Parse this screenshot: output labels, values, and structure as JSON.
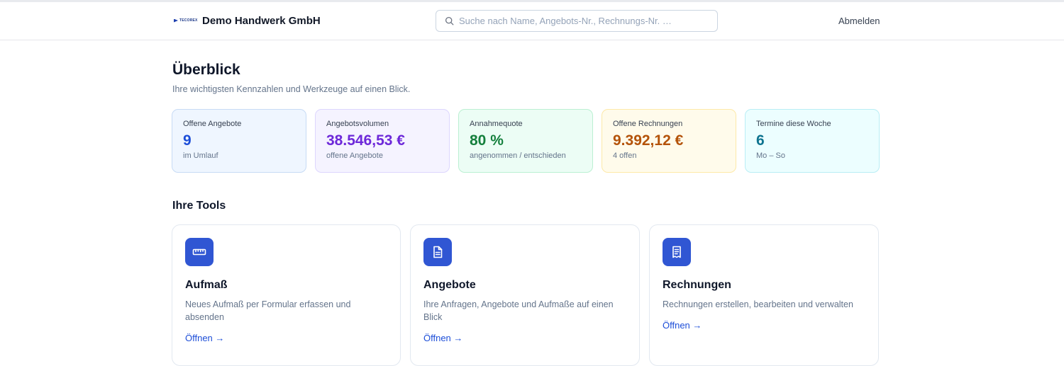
{
  "header": {
    "logo_text": "TECOREX",
    "company_name": "Demo Handwerk GmbH",
    "search": {
      "placeholder": "Suche nach Name, Angebots-Nr., Rechnungs-Nr. …",
      "value": ""
    },
    "logout_label": "Abmelden"
  },
  "page": {
    "title": "Überblick",
    "subtitle": "Ihre wichtigsten Kennzahlen und Werkzeuge auf einen Blick."
  },
  "kpis": [
    {
      "label": "Offene Angebote",
      "value": "9",
      "sub": "im Umlauf",
      "color": "#1d4ed8"
    },
    {
      "label": "Angebotsvolumen",
      "value": "38.546,53 €",
      "sub": "offene Angebote",
      "color": "#6d28d9"
    },
    {
      "label": "Annahmequote",
      "value": "80 %",
      "sub": "angenommen / entschieden",
      "color": "#15803d"
    },
    {
      "label": "Offene Rechnungen",
      "value": "9.392,12 €",
      "sub": "4 offen",
      "color": "#b45309"
    },
    {
      "label": "Termine diese Woche",
      "value": "6",
      "sub": "Mo – So",
      "color": "#0e7490"
    }
  ],
  "tools": {
    "heading": "Ihre Tools",
    "items": [
      {
        "name": "Aufmaß",
        "description": "Neues Aufmaß per Formular erfassen und absenden",
        "open_label": "Öffnen →",
        "icon": "ruler-icon"
      },
      {
        "name": "Angebote",
        "description": "Ihre Anfragen, Angebote und Aufmaße auf einen Blick",
        "open_label": "Öffnen →",
        "icon": "document-icon"
      },
      {
        "name": "Rechnungen",
        "description": "Rechnungen erstellen, bearbeiten und verwalten",
        "open_label": "Öffnen →",
        "icon": "receipt-icon"
      }
    ]
  },
  "colors": {
    "accent": "#3056d3",
    "link": "#1d4ed8"
  }
}
